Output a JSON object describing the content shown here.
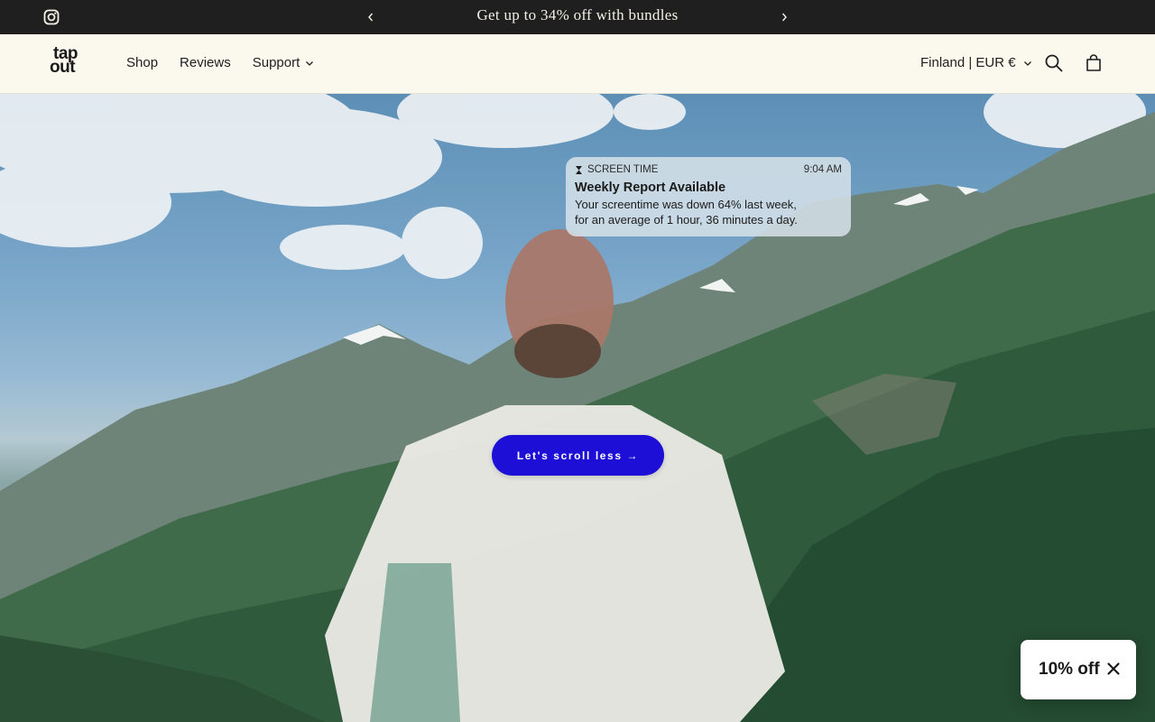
{
  "announcement": {
    "message": "Get up to 34% off with bundles",
    "instagram_icon": "instagram-icon",
    "prev_icon": "chevron-left-icon",
    "next_icon": "chevron-right-icon"
  },
  "header": {
    "logo_line1": "tap",
    "logo_line2": "out",
    "nav": [
      {
        "label": "Shop"
      },
      {
        "label": "Reviews"
      },
      {
        "label": "Support"
      }
    ],
    "locale": "Finland | EUR €",
    "search_icon": "search-icon",
    "cart_icon": "cart-icon"
  },
  "hero": {
    "notification": {
      "app": "SCREEN TIME",
      "time": "9:04 AM",
      "title": "Weekly Report Available",
      "body_line1": "Your screentime was down 64% last week,",
      "body_line2": "for an average of 1 hour, 36 minutes a day."
    },
    "cta_label": "Let's scroll less →"
  },
  "discount_badge": {
    "label": "10% off",
    "close_icon": "close-icon"
  },
  "colors": {
    "announcement_bg": "#1f1f1f",
    "header_bg": "#fbf8ee",
    "cta_bg": "#1d0fd6"
  }
}
